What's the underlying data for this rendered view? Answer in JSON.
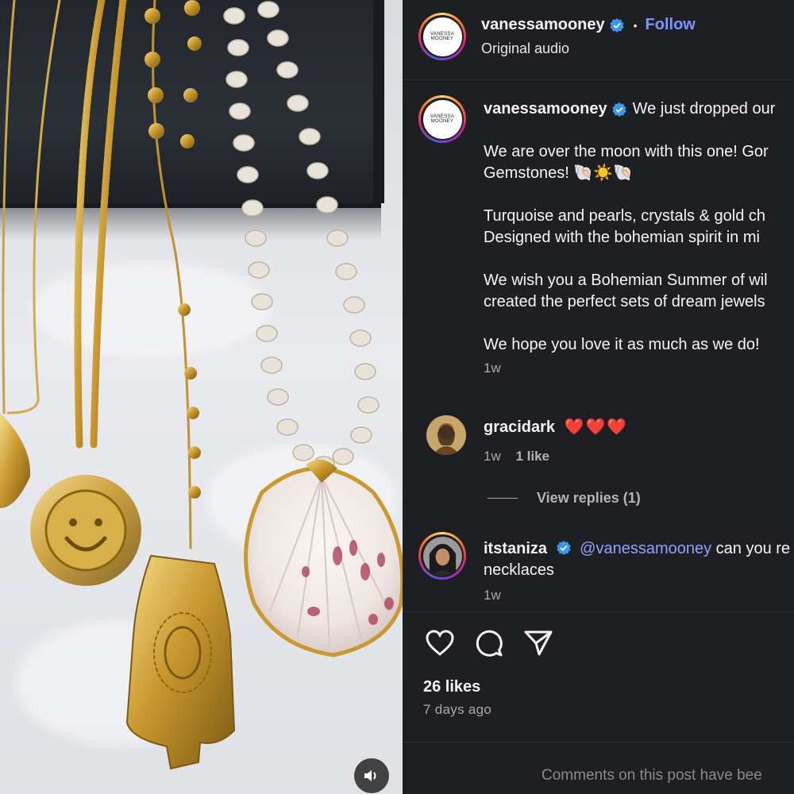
{
  "post": {
    "author": "vanessamooney",
    "author_logo_text": "VANESSA MOONEY",
    "follow_label": "Follow",
    "audio_label": "Original audio",
    "caption_lines": [
      "We just dropped our",
      "We are over the moon with this one! Gor",
      "Gemstones! 🐚☀️🐚",
      "Turquoise and pearls, crystals & gold ch",
      "Designed with the bohemian spirit in mi",
      "We wish you a Bohemian Summer of wil",
      "created the perfect sets of dream jewels",
      "We hope you love it as much as we do!"
    ],
    "caption_age": "1w",
    "likes": "26 likes",
    "posted_ago": "7 days ago",
    "comments_disabled_text": "Comments on this post have bee"
  },
  "comments": [
    {
      "username": "gracidark",
      "text": "❤️❤️❤️",
      "age": "1w",
      "like_count": "1 like",
      "view_replies": "View replies (1)"
    },
    {
      "username": "itstaniza",
      "mention": "@vanessamooney",
      "text_part1": " can you re",
      "text_part2": "necklaces",
      "age": "1w"
    }
  ],
  "icons": {
    "verified": "verified-badge-icon",
    "like": "heart-icon",
    "comment": "comment-bubble-icon",
    "share": "paper-plane-icon",
    "sound": "speaker-icon"
  },
  "colors": {
    "panel_bg": "#1e1f23",
    "follow": "#7e93ff",
    "verified": "#3897f0",
    "mention": "#8ea2ff",
    "heart": "#ff3040"
  }
}
